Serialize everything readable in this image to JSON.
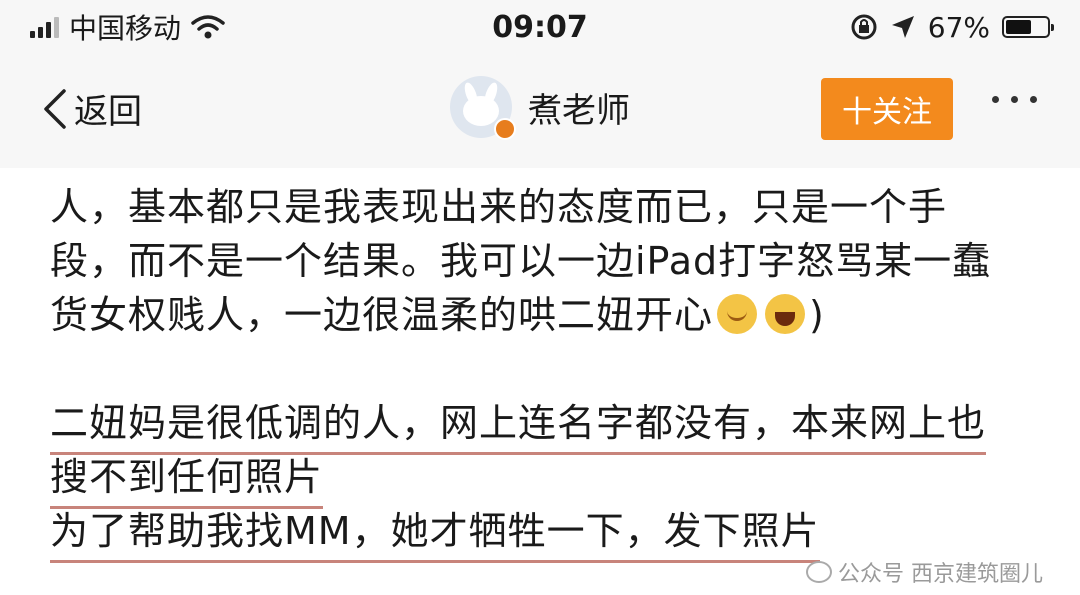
{
  "status_bar": {
    "carrier": "中国移动",
    "time": "09:07",
    "battery_percent": "67%",
    "battery_level": 0.67
  },
  "nav": {
    "back_label": "返回",
    "user_name": "煮老师",
    "follow_label": "十关注"
  },
  "post": {
    "lines": [
      "人，基本都只是我表现出来的态度而已，只是一个手",
      "段，而不是一个结果。我可以一边iPad打字怒骂某一蠢",
      "货女权贱人，一边很温柔的哄二妞开心",
      "二妞妈是很低调的人，网上连名字都没有，本来网上也",
      "搜不到任何照片",
      "为了帮助我找MM，她才牺牲一下，发下照片"
    ],
    "line3_tail": ")"
  },
  "watermark": {
    "text": "公众号 西京建筑圈儿"
  }
}
